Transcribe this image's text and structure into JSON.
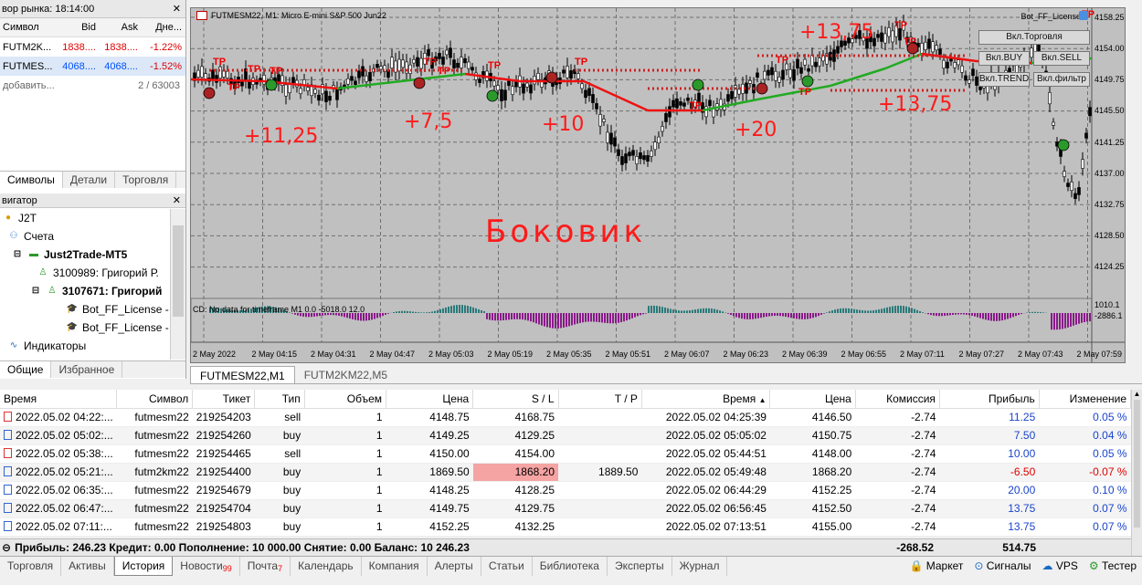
{
  "market_watch": {
    "title": "вор рынка: 18:14:00",
    "columns": [
      "Символ",
      "Bid",
      "Ask",
      "Дне..."
    ],
    "rows": [
      {
        "symbol": "FUTM2K...",
        "bid": "1838....",
        "ask": "1838....",
        "change": "-1.22%"
      },
      {
        "symbol": "FUTMES...",
        "bid": "4068....",
        "ask": "4068....",
        "change": "-1.52%"
      }
    ],
    "add_label": "добавить...",
    "count": "2 / 63003",
    "tabs": [
      "Символы",
      "Детали",
      "Торговля"
    ]
  },
  "navigator": {
    "title": "вигатор",
    "items": [
      {
        "label": "J2T",
        "bold": false
      },
      {
        "label": "Счета",
        "bold": false
      },
      {
        "label": "Just2Trade-MT5",
        "bold": true
      },
      {
        "label": "3100989: Григорий Р.",
        "bold": false
      },
      {
        "label": "3107671: Григорий",
        "bold": true
      },
      {
        "label": "Bot_FF_License -",
        "bold": false
      },
      {
        "label": "Bot_FF_License -",
        "bold": false
      },
      {
        "label": "Индикаторы",
        "bold": false
      }
    ],
    "tabs": [
      "Общие",
      "Избранное"
    ]
  },
  "chart": {
    "title": "FUTMESM22, M1:  Micro E-mini S&P 500 Jun22",
    "bot_label": "Bot_FF_License",
    "buttons": [
      "Вкл.Торговля",
      "Вкл.BUY",
      "Вкл.SELL",
      "Вкл.TREND",
      "Вкл.фильтр"
    ],
    "price_labels": [
      "4158.25",
      "4154.00",
      "4149.75",
      "4145.50",
      "4141.25",
      "4137.00",
      "4132.75",
      "4128.50",
      "4124.25"
    ],
    "indicator_label": "CD: No data for timeframe M1 0.0 -5018.0 12.0",
    "indicator_scale": [
      "1010.1",
      "-2886.1"
    ],
    "time_labels": [
      "2 May 2022",
      "2 May 04:15",
      "2 May 04:31",
      "2 May 04:47",
      "2 May 05:03",
      "2 May 05:19",
      "2 May 05:35",
      "2 May 05:51",
      "2 May 06:07",
      "2 May 06:23",
      "2 May 06:39",
      "2 May 06:55",
      "2 May 07:11",
      "2 May 07:27",
      "2 May 07:43",
      "2 May 07:59"
    ],
    "annotations": [
      "+11,25",
      "+7,5",
      "+10",
      "+20",
      "+13,75",
      "+13,75",
      "Боковик"
    ]
  },
  "symbol_tabs": [
    "FUTMESM22,M1",
    "FUTM2KM22,M5"
  ],
  "history": {
    "columns": [
      "Время",
      "Символ",
      "Тикет",
      "Тип",
      "Объем",
      "Цена",
      "S / L",
      "T / P",
      "Время",
      "Цена",
      "Комиссия",
      "Прибыль",
      "Изменение"
    ],
    "rows": [
      [
        "2022.05.02 04:22:...",
        "futmesm22",
        "219254203",
        "sell",
        "1",
        "4148.75",
        "4168.75",
        "",
        "2022.05.02 04:25:39",
        "4146.50",
        "-2.74",
        "11.25",
        "0.05 %"
      ],
      [
        "2022.05.02 05:02:...",
        "futmesm22",
        "219254260",
        "buy",
        "1",
        "4149.25",
        "4129.25",
        "",
        "2022.05.02 05:05:02",
        "4150.75",
        "-2.74",
        "7.50",
        "0.04 %"
      ],
      [
        "2022.05.02 05:38:...",
        "futmesm22",
        "219254465",
        "sell",
        "1",
        "4150.00",
        "4154.00",
        "",
        "2022.05.02 05:44:51",
        "4148.00",
        "-2.74",
        "10.00",
        "0.05 %"
      ],
      [
        "2022.05.02 05:21:...",
        "futm2km22",
        "219254400",
        "buy",
        "1",
        "1869.50",
        "1868.20",
        "1889.50",
        "2022.05.02 05:49:48",
        "1868.20",
        "-2.74",
        "-6.50",
        "-0.07 %"
      ],
      [
        "2022.05.02 06:35:...",
        "futmesm22",
        "219254679",
        "buy",
        "1",
        "4148.25",
        "4128.25",
        "",
        "2022.05.02 06:44:29",
        "4152.25",
        "-2.74",
        "20.00",
        "0.10 %"
      ],
      [
        "2022.05.02 06:47:...",
        "futmesm22",
        "219254704",
        "buy",
        "1",
        "4149.75",
        "4129.75",
        "",
        "2022.05.02 06:56:45",
        "4152.50",
        "-2.74",
        "13.75",
        "0.07 %"
      ],
      [
        "2022.05.02 07:11:...",
        "futmesm22",
        "219254803",
        "buy",
        "1",
        "4152.25",
        "4132.25",
        "",
        "2022.05.02 07:13:51",
        "4155.00",
        "-2.74",
        "13.75",
        "0.07 %"
      ]
    ],
    "summary": "Прибыль: 246.23  Кредит: 0.00  Пополнение: 10 000.00  Снятие: 0.00  Баланс: 10 246.23",
    "total_commission": "-268.52",
    "total_profit": "514.75"
  },
  "main_tabs": [
    {
      "label": "Торговля",
      "badge": ""
    },
    {
      "label": "Активы",
      "badge": ""
    },
    {
      "label": "История",
      "badge": ""
    },
    {
      "label": "Новости",
      "badge": "99"
    },
    {
      "label": "Почта",
      "badge": "7"
    },
    {
      "label": "Календарь",
      "badge": ""
    },
    {
      "label": "Компания",
      "badge": ""
    },
    {
      "label": "Алерты",
      "badge": ""
    },
    {
      "label": "Статьи",
      "badge": ""
    },
    {
      "label": "Библиотека",
      "badge": ""
    },
    {
      "label": "Эксперты",
      "badge": ""
    },
    {
      "label": "Журнал",
      "badge": ""
    }
  ],
  "right_buttons": [
    "Маркет",
    "Сигналы",
    "VPS",
    "Тестер"
  ]
}
